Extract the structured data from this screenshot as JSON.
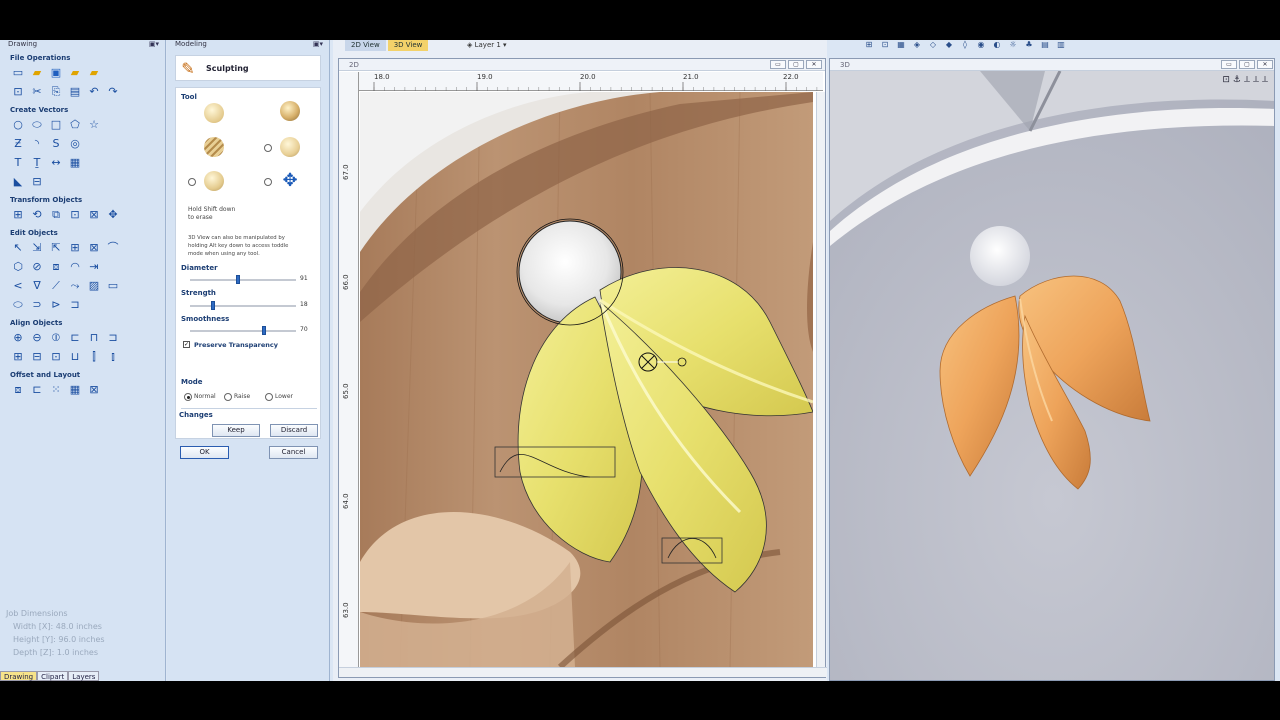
{
  "drawing_panel": {
    "title": "Drawing",
    "sections": {
      "file_operations": "File Operations",
      "create_vectors": "Create Vectors",
      "transform_objects": "Transform Objects",
      "edit_objects": "Edit Objects",
      "align_objects": "Align Objects",
      "offset_and_layout": "Offset and Layout"
    },
    "job_dimensions": {
      "heading": "Job Dimensions",
      "width": "Width  [X]: 48.0 inches",
      "height": "Height [Y]: 96.0 inches",
      "depth": "Depth  [Z]: 1.0 inches"
    },
    "bottom_tabs": [
      "Drawing",
      "Clipart",
      "Layers"
    ]
  },
  "modelling_panel": {
    "title": "Modeling",
    "header": "Sculpting",
    "tool_label": "Tool",
    "hint_shift": "Hold Shift down\nto erase",
    "hint_3d": "3D View can also be manipulated by\nholding Alt key down to access toddle\nmode when using any tool.",
    "diameter": {
      "label": "Diameter",
      "value": "91",
      "fraction": 0.45
    },
    "strength": {
      "label": "Strength",
      "value": "18",
      "fraction": 0.22
    },
    "smoothness": {
      "label": "Smoothness",
      "value": "70",
      "fraction": 0.7
    },
    "preserve_transparency": "Preserve Transparency",
    "mode_label": "Mode",
    "mode_options": [
      "Normal",
      "Raise",
      "Lower"
    ],
    "changes_label": "Changes",
    "keep_button": "Keep",
    "discard_button": "Discard",
    "ok_button": "OK",
    "cancel_button": "Cancel"
  },
  "view2d": {
    "tabs": [
      "2D View",
      "3D View"
    ],
    "layer": "Layer 1",
    "window_title": "2D",
    "ruler_top": [
      "18.0",
      "19.0",
      "20.0",
      "21.0",
      "22.0"
    ],
    "ruler_left": [
      "67.0",
      "66.0",
      "65.0",
      "64.0",
      "63.0"
    ]
  },
  "view3d": {
    "window_title": "3D"
  },
  "colors": {
    "leaf_yellow": "#ece57a",
    "leaf_orange": "#f0ab62",
    "wood": "#b58c6a",
    "accent_tab": "#f3d26a"
  }
}
